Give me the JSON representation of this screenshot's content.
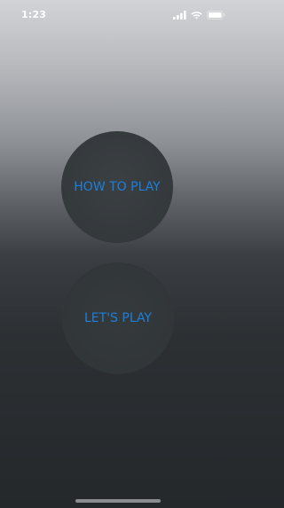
{
  "status_bar": {
    "time": "1:23",
    "icons": [
      "cellular-signal-icon",
      "wifi-icon",
      "battery-icon"
    ]
  },
  "buttons": {
    "how_to_play": "HOW TO PLAY",
    "lets_play": "LET'S PLAY"
  },
  "colors": {
    "accent": "#1e7fdc",
    "background_top": "#d2d3d7",
    "background_bottom": "#25282b",
    "button_fill": "#34393c"
  }
}
